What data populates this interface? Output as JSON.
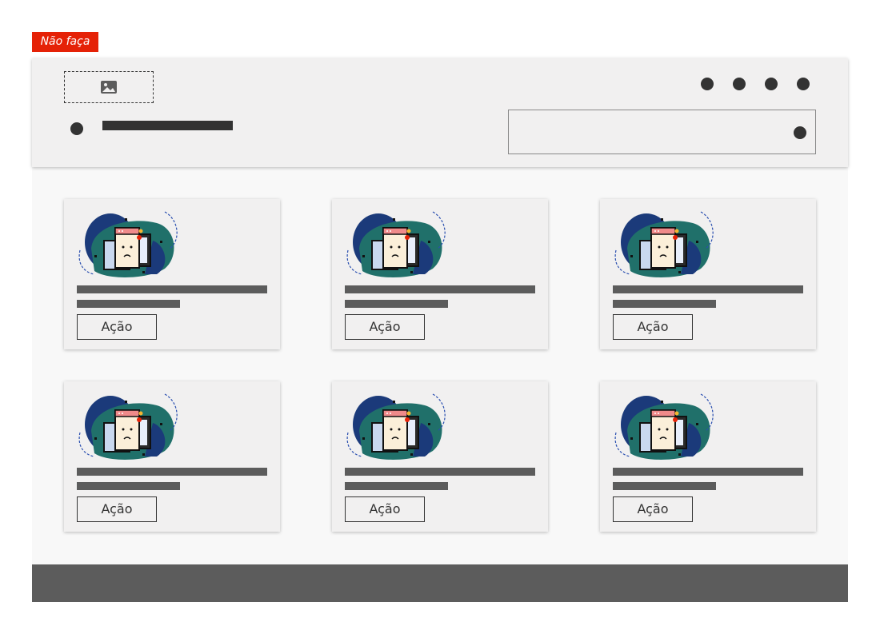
{
  "tag": {
    "label": "Não faça",
    "color": "#e52207"
  },
  "header": {
    "logo_icon": "image-icon",
    "menu_icon": "menu-dot",
    "action_icons": [
      "action-icon-1",
      "action-icon-2",
      "action-icon-3",
      "action-icon-4"
    ],
    "search_icon": "search-dot"
  },
  "cards": [
    {
      "illustration": "devices-error-illustration",
      "action_label": "Ação"
    },
    {
      "illustration": "devices-error-illustration",
      "action_label": "Ação"
    },
    {
      "illustration": "devices-error-illustration",
      "action_label": "Ação"
    },
    {
      "illustration": "devices-error-illustration",
      "action_label": "Ação"
    },
    {
      "illustration": "devices-error-illustration",
      "action_label": "Ação"
    },
    {
      "illustration": "devices-error-illustration",
      "action_label": "Ação"
    }
  ],
  "colors": {
    "header_bg": "#f1f0f0",
    "page_bg": "#f8f8f8",
    "placeholder_dark": "#333333",
    "text_placeholder": "#5c5c5c",
    "footer_bg": "#5c5c5c"
  }
}
